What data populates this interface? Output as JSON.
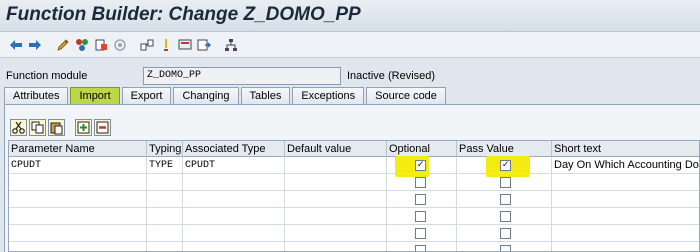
{
  "window": {
    "title": "Function Builder: Change Z_DOMO_PP"
  },
  "toolbar": {
    "buttons": [
      {
        "icon": "back-arrow-icon"
      },
      {
        "icon": "forward-arrow-icon"
      },
      {
        "icon": "edit-pencil-icon"
      },
      {
        "icon": "check-syntax-icon"
      },
      {
        "icon": "object-list-icon"
      },
      {
        "icon": "activate-icon"
      },
      {
        "icon": "where-used-icon"
      },
      {
        "icon": "test-icon"
      },
      {
        "icon": "display-object-icon"
      },
      {
        "icon": "navigate-icon"
      },
      {
        "icon": "hierarchy-icon"
      }
    ]
  },
  "function_module": {
    "label": "Function module",
    "value": "Z_DOMO_PP",
    "status": "Inactive (Revised)"
  },
  "tabs": [
    {
      "label": "Attributes",
      "active": false
    },
    {
      "label": "Import",
      "active": true
    },
    {
      "label": "Export",
      "active": false
    },
    {
      "label": "Changing",
      "active": false
    },
    {
      "label": "Tables",
      "active": false
    },
    {
      "label": "Exceptions",
      "active": false
    },
    {
      "label": "Source code",
      "active": false
    }
  ],
  "table_toolbar": {
    "buttons": [
      {
        "icon": "cut-icon"
      },
      {
        "icon": "copy-icon"
      },
      {
        "icon": "paste-icon"
      },
      {
        "icon": "insert-row-icon"
      },
      {
        "icon": "delete-row-icon"
      }
    ]
  },
  "grid": {
    "headers": [
      "Parameter Name",
      "Typing",
      "Associated Type",
      "Default value",
      "Optional",
      "Pass Value",
      "Short text"
    ],
    "rows": [
      {
        "param": "CPUDT",
        "typing": "TYPE",
        "assoc": "CPUDT",
        "default": "",
        "optional": true,
        "pass_value": true,
        "short_text": "Day On Which Accounting Docu"
      }
    ],
    "empty_rows": 5
  },
  "colors": {
    "highlight": "#f4ec10",
    "active_tab": "#bcd64a"
  }
}
